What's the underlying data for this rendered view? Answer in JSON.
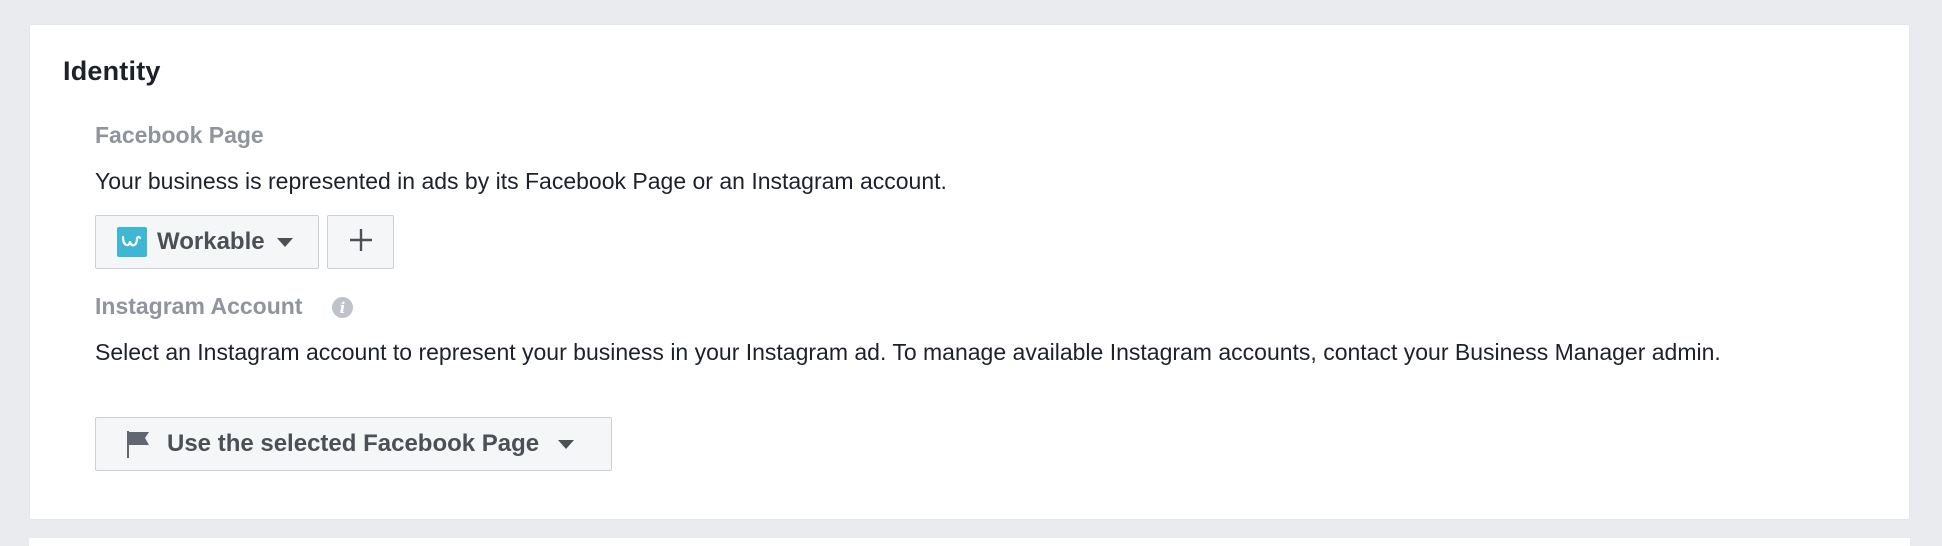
{
  "section": {
    "title": "Identity"
  },
  "facebook_page": {
    "label": "Facebook Page",
    "description": "Your business is represented in ads by its Facebook Page or an Instagram account.",
    "selected_page": "Workable",
    "page_avatar_icon": "workable-logo-icon",
    "add_button_icon": "plus-icon"
  },
  "instagram_account": {
    "label": "Instagram Account",
    "info_icon": "info-icon",
    "description": "Select an Instagram account to represent your business in your Instagram ad. To manage available Instagram accounts, contact your Business Manager admin.",
    "selected_option": "Use the selected Facebook Page",
    "option_icon": "flag-icon"
  },
  "colors": {
    "page_background": "#e9ebee",
    "card_background": "#ffffff",
    "label_gray": "#90949c",
    "button_text": "#4b4f56",
    "workable_brand": "#3fb6d3"
  }
}
